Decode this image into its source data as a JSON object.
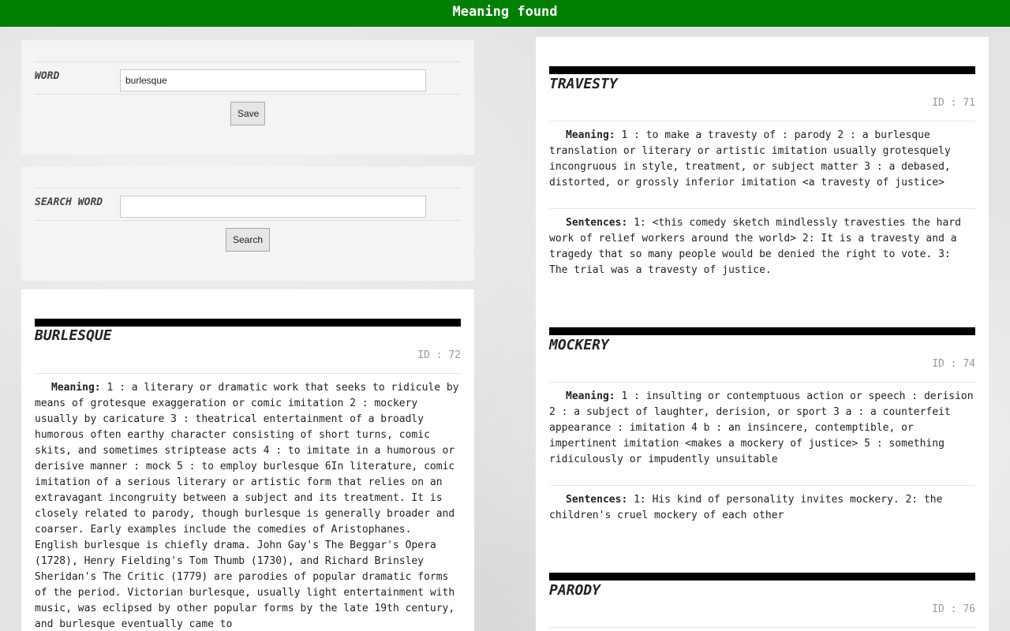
{
  "header": {
    "title": "Meaning found"
  },
  "save_form": {
    "label": "WORD",
    "value": "burlesque",
    "button": "Save"
  },
  "search_form": {
    "label": "SEARCH WORD",
    "value": "",
    "button": "Search"
  },
  "left_entries": [
    {
      "word": "BURLESQUE",
      "id_text": "ID : 72",
      "meaning_label": "Meaning:",
      "meaning": "1 :  a literary or dramatic work that seeks to ridicule by means of grotesque exaggeration or comic imitation 2 :  mockery usually by caricature 3 :  theatrical entertainment of a broadly humorous often earthy character consisting of short turns, comic skits, and sometimes striptease acts 4 :  to imitate in a humorous or derisive manner :  mock 5 :  to employ burlesque 6In literature, comic imitation of a serious literary or artistic form that relies on an extravagant incongruity between a subject and its treatment. It is closely related to parody, though burlesque is generally broader and coarser. Early examples include the comedies of Aristophanes. English burlesque is chiefly drama. John Gay's The Beggar's Opera (1728), Henry Fielding's Tom Thumb (1730), and Richard Brinsley Sheridan's The Critic (1779) are parodies of popular dramatic forms of the period. Victorian burlesque, usually light entertainment with music, was eclipsed by other popular forms by the late 19th century, and burlesque eventually came to"
    }
  ],
  "right_entries": [
    {
      "word": "TRAVESTY",
      "id_text": "ID : 71",
      "meaning_label": "Meaning:",
      "meaning": "1 :  to make a travesty of :  parody 2 :  a burlesque translation or literary or artistic imitation usually grotesquely incongruous in style, treatment, or subject matter 3 :  a debased, distorted, or grossly inferior imitation <a travesty of justice>",
      "sentences_label": "Sentences:",
      "sentences": "1: <this comedy sketch mindlessly travesties the hard work of relief workers around the world> 2: It is a travesty and a tragedy that so many people would be denied the right to vote. 3: The trial was a travesty of justice."
    },
    {
      "word": "MOCKERY",
      "id_text": "ID : 74",
      "meaning_label": "Meaning:",
      "meaning": "1 :  insulting or contemptuous action or speech :  derision 2 :  a subject of laughter, derision, or sport 3 a :  a counterfeit appearance :  imitation 4 b :  an insincere, contemptible, or impertinent imitation <makes a mockery of justice> 5 :  something ridiculously or impudently unsuitable",
      "sentences_label": "Sentences:",
      "sentences": "1: His kind of personality invites mockery. 2: the children's cruel mockery of each other"
    },
    {
      "word": "PARODY",
      "id_text": "ID : 76"
    }
  ]
}
